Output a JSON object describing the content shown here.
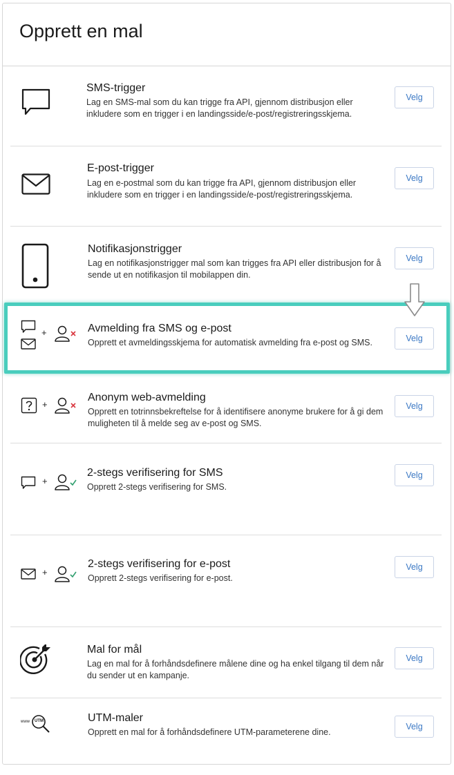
{
  "header": {
    "title": "Opprett en mal"
  },
  "items": [
    {
      "title": "SMS-trigger",
      "desc": "Lag en SMS-mal som du kan trigge fra API, gjennom distribusjon eller inkludere som en trigger i en landingsside/e-post/registreringsskjema.",
      "button": "Velg",
      "icon": "chat-bubble-icon"
    },
    {
      "title": "E-post-trigger",
      "desc": "Lag en e-postmal som du kan trigge fra API, gjennom distribusjon eller inkludere som en trigger i en landingsside/e-post/registreringsskjema.",
      "button": "Velg",
      "icon": "envelope-icon"
    },
    {
      "title": "Notifikasjonstrigger",
      "desc": "Lag en notifikasjonstrigger mal som kan trigges fra API eller distribusjon for å sende ut en notifikasjon til mobilappen din.",
      "button": "Velg",
      "icon": "mobile-phone-icon"
    },
    {
      "title": "Avmelding fra SMS og e-post",
      "desc": "Opprett et avmeldingsskjema for automatisk avmelding fra e-post og SMS.",
      "button": "Velg",
      "icon": "unsubscribe-icon"
    },
    {
      "title": "Anonym web-avmelding",
      "desc": "Opprett en totrinnsbekreftelse for å identifisere anonyme brukere for å gi dem muligheten til å melde seg av e-post og SMS.",
      "button": "Velg",
      "icon": "anonymous-unsubscribe-icon"
    },
    {
      "title": "2-stegs verifisering for SMS",
      "desc": "Opprett 2-stegs verifisering for SMS.",
      "button": "Velg",
      "icon": "sms-verify-icon"
    },
    {
      "title": "2-stegs verifisering for e-post",
      "desc": "Opprett 2-stegs verifisering for e-post.",
      "button": "Velg",
      "icon": "email-verify-icon"
    },
    {
      "title": "Mal for mål",
      "desc": "Lag en mal for å forhåndsdefinere målene dine og ha enkel tilgang til dem når du sender ut en kampanje.",
      "button": "Velg",
      "icon": "target-icon"
    },
    {
      "title": "UTM-maler",
      "desc": "Opprett en mal for å forhåndsdefinere UTM-parameterene dine.",
      "button": "Velg",
      "icon": "utm-search-icon"
    }
  ],
  "symbols": {
    "plus": "+",
    "utm_small": "www",
    "utm_badge": "UTM"
  },
  "colors": {
    "highlight": "#49cdbd",
    "button_text": "#3b78c4",
    "error_x": "#d9363e",
    "check": "#2f9e6e"
  }
}
